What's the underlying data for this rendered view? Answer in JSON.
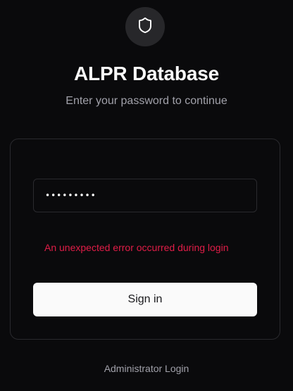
{
  "header": {
    "icon": "shield-icon",
    "title": "ALPR Database",
    "subtitle": "Enter your password to continue"
  },
  "login_form": {
    "password_value": "•••••••••",
    "error_message": "An unexpected error occurred during login",
    "submit_label": "Sign in"
  },
  "footer": {
    "admin_link_label": "Administrator Login"
  },
  "colors": {
    "background": "#0a0a0c",
    "error": "#e11d48",
    "button_bg": "#fafafa",
    "muted_text": "#a1a1aa"
  }
}
